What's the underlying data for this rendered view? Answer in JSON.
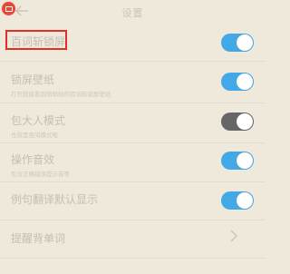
{
  "header": {
    "title": "设置"
  },
  "settings": [
    {
      "label": "百词斩锁屏",
      "subtitle": "",
      "toggle": "on"
    },
    {
      "label": "锁屏壁纸",
      "subtitle": "打开就能看到萌萌哒的百词斩锁屏壁纸",
      "toggle": "on"
    },
    {
      "label": "包大人模式",
      "subtitle": "也就是夜间模式啦",
      "toggle": "off"
    },
    {
      "label": "操作音效",
      "subtitle": "包含正确错误提示音等",
      "toggle": "on"
    },
    {
      "label": "例句翻译默认显示",
      "subtitle": "",
      "toggle": "on"
    },
    {
      "label": "提醒背单词",
      "subtitle": "",
      "toggle": ""
    }
  ],
  "icons": {
    "app": "app-icon",
    "back": "back-arrow-icon",
    "chevron": "chevron-right-icon"
  },
  "colors": {
    "background": "#efe9dc",
    "toggle_on": "#43a9e6",
    "toggle_off": "#666666",
    "highlight": "#e0302a",
    "text": "#c5bdb0"
  }
}
